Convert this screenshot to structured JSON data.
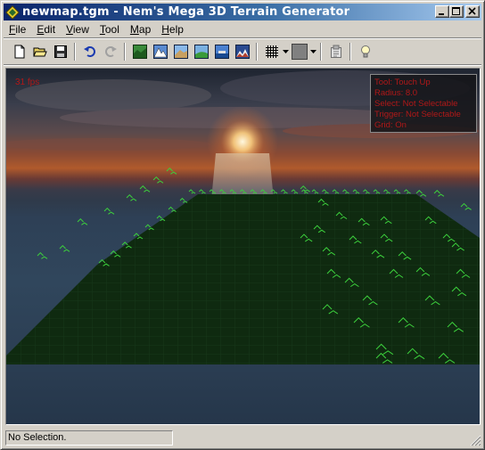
{
  "window": {
    "title": "newmap.tgm - Nem's Mega 3D Terrain Generator",
    "minimize_label": "_",
    "maximize_label": "□",
    "close_label": "×"
  },
  "menu": {
    "items": [
      {
        "label": "File",
        "underline": "F",
        "rest": "ile"
      },
      {
        "label": "Edit",
        "underline": "E",
        "rest": "dit"
      },
      {
        "label": "View",
        "underline": "V",
        "rest": "iew"
      },
      {
        "label": "Tool",
        "underline": "T",
        "rest": "ool"
      },
      {
        "label": "Map",
        "underline": "M",
        "rest": "ap"
      },
      {
        "label": "Help",
        "underline": "H",
        "rest": "elp"
      }
    ]
  },
  "toolbar": {
    "icons": [
      "new-file-icon",
      "open-folder-icon",
      "save-icon",
      "undo-icon",
      "redo-icon",
      "terrain-view-1-icon",
      "terrain-view-2-icon",
      "terrain-view-3-icon",
      "terrain-view-4-icon",
      "terrain-view-5-icon",
      "terrain-view-6-icon",
      "grid-icon",
      "color-swatch-icon",
      "properties-icon",
      "lightbulb-icon"
    ],
    "swatch_color": "#808080"
  },
  "viewport": {
    "fps": "31 fps",
    "info": [
      "Tool: Touch Up",
      "Radius: 8.0",
      "Select: Not Selectable",
      "Trigger: Not Selectable",
      "Grid: On"
    ],
    "info_color": "#b01818",
    "terrain_color": "#0f2a10",
    "marker_color": "#3cd03c"
  },
  "status": {
    "text": "No Selection."
  }
}
